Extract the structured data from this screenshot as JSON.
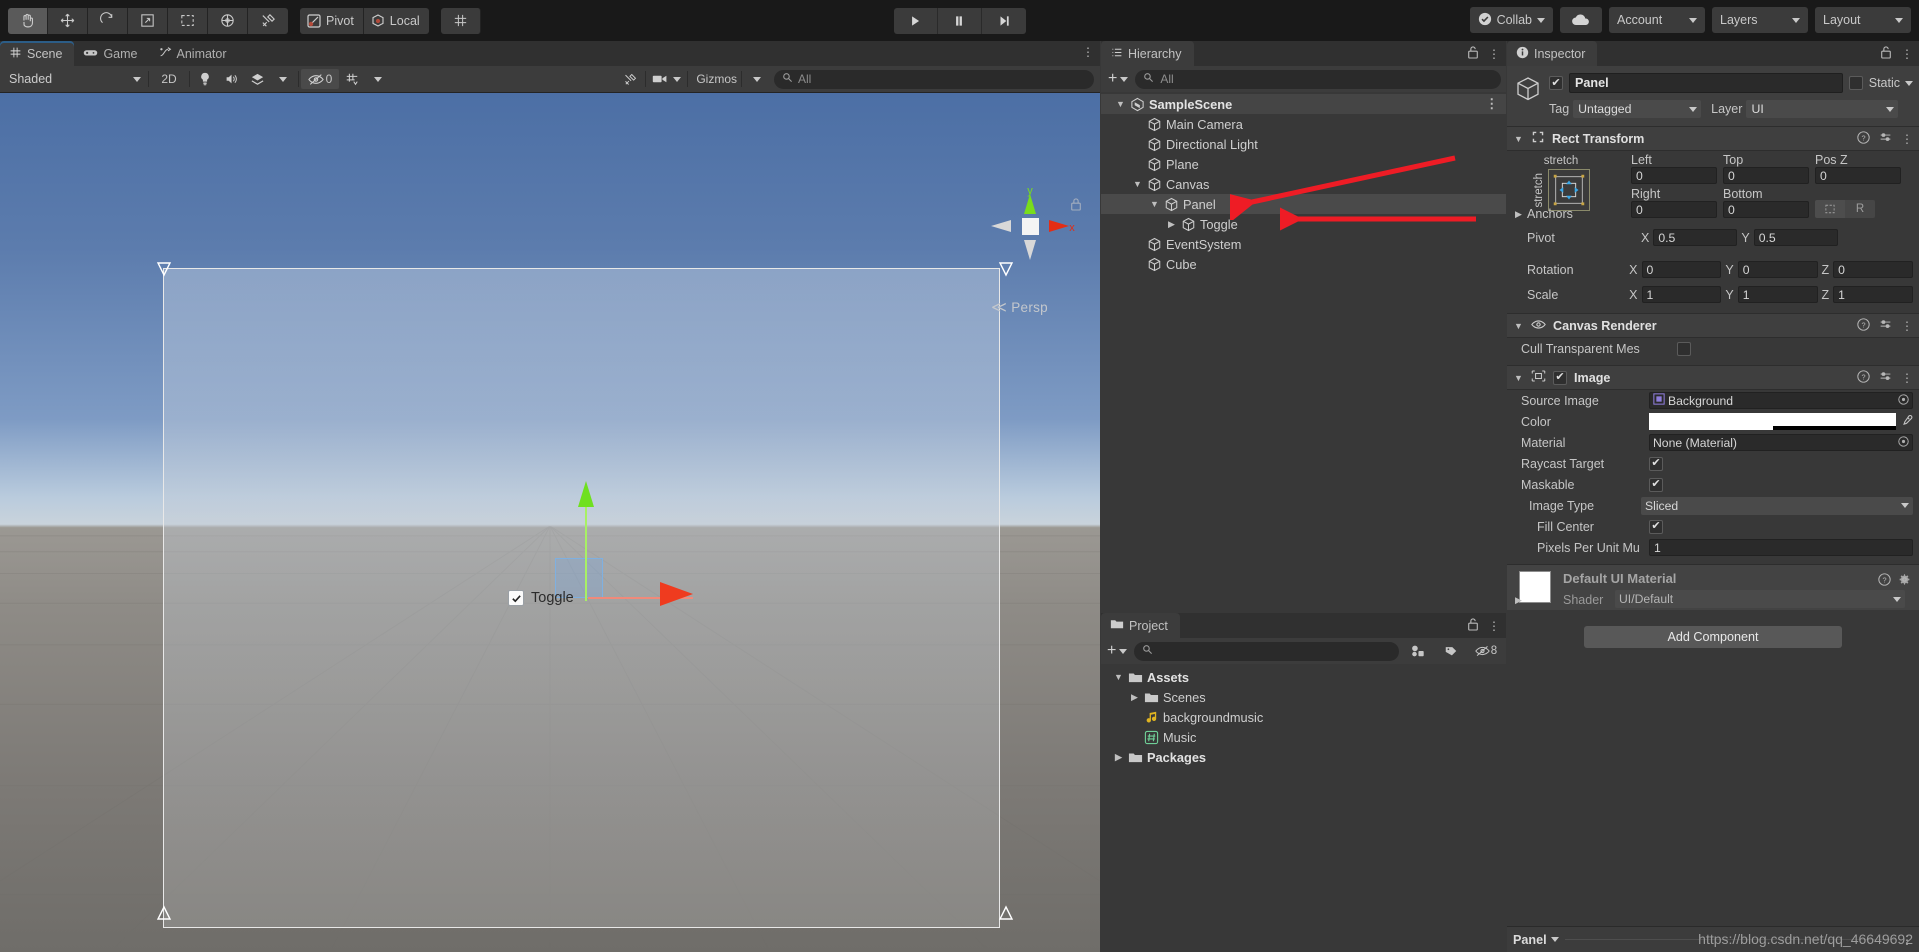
{
  "toolbar": {
    "tools": [
      {
        "name": "hand-tool",
        "icon": "hand-icon",
        "active": true
      },
      {
        "name": "move-tool",
        "icon": "move-icon",
        "active": false
      },
      {
        "name": "rotate-tool",
        "icon": "rotate-icon",
        "active": false
      },
      {
        "name": "scale-tool",
        "icon": "scale-icon",
        "active": false
      },
      {
        "name": "rect-tool",
        "icon": "rect-icon",
        "active": false
      },
      {
        "name": "transform-tool",
        "icon": "transform-icon",
        "active": false
      },
      {
        "name": "custom-tool",
        "icon": "wrench-icon",
        "active": false
      }
    ],
    "pivot_label": "Pivot",
    "local_label": "Local",
    "snap_label": "",
    "play_label": "Play",
    "pause_label": "Pause",
    "step_label": "Step",
    "collab_label": "Collab",
    "cloud_label": "",
    "account_label": "Account",
    "layers_label": "Layers",
    "layout_label": "Layout"
  },
  "scene": {
    "tabs": [
      {
        "label": "Scene",
        "icon": "grid-icon",
        "active": true
      },
      {
        "label": "Game",
        "icon": "gamepad-icon",
        "active": false
      },
      {
        "label": "Animator",
        "icon": "animator-icon",
        "active": false
      }
    ],
    "shading_mode": "Shaded",
    "mode_2d": "2D",
    "hidden_count": "0",
    "gizmos_label": "Gizmos",
    "search_placeholder": "All",
    "perspective_label": "Persp",
    "axis_x": "x",
    "axis_y": "y",
    "toggle_label": "Toggle"
  },
  "hierarchy": {
    "title": "Hierarchy",
    "search_placeholder": "All",
    "items": [
      {
        "label": "SampleScene",
        "depth": 0,
        "twisty": "open",
        "icon": "scene-icon",
        "selected": false,
        "is_scene": true
      },
      {
        "label": "Main Camera",
        "depth": 1,
        "twisty": "none",
        "icon": "gameobject-icon",
        "selected": false,
        "is_scene": false
      },
      {
        "label": "Directional Light",
        "depth": 1,
        "twisty": "none",
        "icon": "gameobject-icon",
        "selected": false,
        "is_scene": false
      },
      {
        "label": "Plane",
        "depth": 1,
        "twisty": "none",
        "icon": "gameobject-icon",
        "selected": false,
        "is_scene": false
      },
      {
        "label": "Canvas",
        "depth": 1,
        "twisty": "open",
        "icon": "gameobject-icon",
        "selected": false,
        "is_scene": false
      },
      {
        "label": "Panel",
        "depth": 2,
        "twisty": "open",
        "icon": "gameobject-icon",
        "selected": true,
        "is_scene": false
      },
      {
        "label": "Toggle",
        "depth": 3,
        "twisty": "closed",
        "icon": "gameobject-icon",
        "selected": false,
        "is_scene": false
      },
      {
        "label": "EventSystem",
        "depth": 1,
        "twisty": "none",
        "icon": "gameobject-icon",
        "selected": false,
        "is_scene": false
      },
      {
        "label": "Cube",
        "depth": 1,
        "twisty": "none",
        "icon": "gameobject-icon",
        "selected": false,
        "is_scene": false
      }
    ]
  },
  "project": {
    "title": "Project",
    "search_placeholder": "",
    "badge_count": "8",
    "items": [
      {
        "label": "Assets",
        "depth": 0,
        "twisty": "open",
        "icon": "folder-icon",
        "bold": true
      },
      {
        "label": "Scenes",
        "depth": 1,
        "twisty": "closed",
        "icon": "folder-icon",
        "bold": false
      },
      {
        "label": "backgroundmusic",
        "depth": 1,
        "twisty": "none",
        "icon": "audio-icon",
        "bold": false
      },
      {
        "label": "Music",
        "depth": 1,
        "twisty": "none",
        "icon": "script-icon",
        "bold": false
      },
      {
        "label": "Packages",
        "depth": 0,
        "twisty": "closed",
        "icon": "folder-icon",
        "bold": true
      }
    ]
  },
  "inspector": {
    "title": "Inspector",
    "object_name": "Panel",
    "object_enabled": true,
    "static_label": "Static",
    "static_checked": false,
    "tag_label": "Tag",
    "tag_value": "Untagged",
    "layer_label": "Layer",
    "layer_value": "UI",
    "rect_transform": {
      "title": "Rect Transform",
      "anchor_preset_top": "stretch",
      "anchor_preset_side": "stretch",
      "left_label": "Left",
      "left_value": "0",
      "top_label": "Top",
      "top_value": "0",
      "posz_label": "Pos Z",
      "posz_value": "0",
      "right_label": "Right",
      "right_value": "0",
      "bottom_label": "Bottom",
      "bottom_value": "0",
      "blueprint_label": "",
      "raw_label": "R",
      "anchors_label": "Anchors",
      "pivot_label": "Pivot",
      "pivot_x_label": "X",
      "pivot_x": "0.5",
      "pivot_y_label": "Y",
      "pivot_y": "0.5",
      "rotation_label": "Rotation",
      "rot_x": "0",
      "rot_y": "0",
      "rot_z": "0",
      "scale_label": "Scale",
      "scale_x": "1",
      "scale_y": "1",
      "scale_z": "1",
      "x_label": "X",
      "y_label": "Y",
      "z_label": "Z"
    },
    "canvas_renderer": {
      "title": "Canvas Renderer",
      "cull_label": "Cull Transparent Mes",
      "cull_checked": false
    },
    "image": {
      "title": "Image",
      "enabled": true,
      "source_image_label": "Source Image",
      "source_image_value": "Background",
      "color_label": "Color",
      "color_value": "#FFFFFF",
      "material_label": "Material",
      "material_value": "None (Material)",
      "raycast_label": "Raycast Target",
      "raycast_checked": true,
      "maskable_label": "Maskable",
      "maskable_checked": true,
      "image_type_label": "Image Type",
      "image_type_value": "Sliced",
      "fill_center_label": "Fill Center",
      "fill_center_checked": true,
      "ppum_label": "Pixels Per Unit Mu",
      "ppum_value": "1"
    },
    "material": {
      "title": "Default UI Material",
      "shader_label": "Shader",
      "shader_value": "UI/Default"
    },
    "add_component_label": "Add Component"
  },
  "statusbar": {
    "selected_object": "Panel",
    "watermark": "https://blog.csdn.net/qq_46649692"
  },
  "colors": {
    "accent_blue": "#2c5d87",
    "panel_bg": "#383838",
    "toolbar_bg": "#191919",
    "annotation_red": "#ee1c25"
  }
}
